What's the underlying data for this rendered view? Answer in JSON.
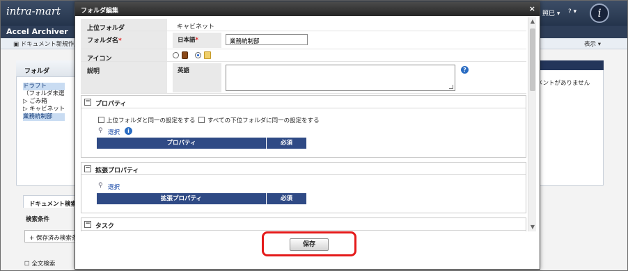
{
  "app": {
    "logo": "intra-mart",
    "subtitle": "Accel Archiver",
    "user": "照巳 ▾",
    "help": "? ▾",
    "avatar": "i",
    "toolbar": {
      "new_document": "ドキュメント新規作成",
      "view": "表示 ▾"
    },
    "folder_panel": {
      "header": "フォルダ",
      "tree": [
        "ドラフト",
        "（フォルダ未選",
        "▷ ごみ箱",
        "▷ キャビネット",
        "業務統制部"
      ]
    },
    "right_panel": {
      "message": "メントがありません"
    },
    "search": {
      "tab": "ドキュメント検索",
      "condition": "検索条件",
      "saved": "保存済み検索条",
      "fulltext": "全文検索"
    }
  },
  "modal": {
    "title": "フォルダ編集",
    "close": "×",
    "rows": {
      "parent_label": "上位フォルダ",
      "parent_value": "キャビネット",
      "name_label": "フォルダ名",
      "required_mark": "*",
      "name_lang": "日本語",
      "name_value": "業務統制部",
      "icon_label": "アイコン",
      "desc_label": "説明",
      "desc_lang": "英語",
      "desc_value": ""
    },
    "properties": {
      "header": "プロパティ",
      "toggle": "−",
      "check1": "上位フォルダと同一の設定をする",
      "check2": "すべての下位フォルダに同一の設定をする",
      "select": "選択",
      "col_property": "プロパティ",
      "col_required": "必須"
    },
    "ext_properties": {
      "header": "拡張プロパティ",
      "toggle": "−",
      "select": "選択",
      "col_property": "拡張プロパティ",
      "col_required": "必須"
    },
    "task": {
      "header": "タスク",
      "toggle": "−"
    },
    "save": "保存",
    "help_icon": "?",
    "info_icon": "i"
  }
}
